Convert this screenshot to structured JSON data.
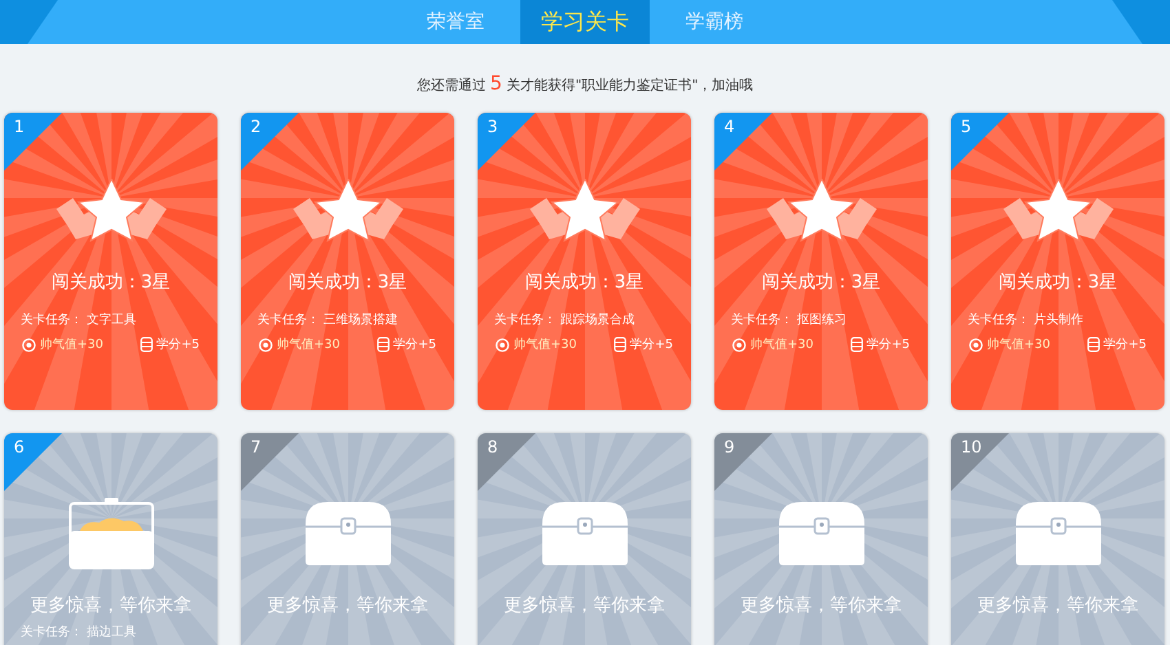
{
  "tabs": [
    {
      "label": "荣誉室",
      "selected": false
    },
    {
      "label": "学习关卡",
      "selected": true
    },
    {
      "label": "学霸榜",
      "selected": false
    }
  ],
  "notice": {
    "before": "您还需通过",
    "count": "5",
    "after": "关才能获得\"职业能力鉴定证书\"，加油哦"
  },
  "levels": [
    {
      "number": "1",
      "kind": "completed",
      "title": "闯关成功：3星",
      "task_label": "关卡任务：",
      "task": "文字工具",
      "rewards": [
        {
          "kind": "coin",
          "text": "帅气值+30"
        },
        {
          "kind": "credit",
          "text": "学分+5"
        }
      ]
    },
    {
      "number": "2",
      "kind": "completed",
      "title": "闯关成功：3星",
      "task_label": "关卡任务：",
      "task": "三维场景搭建",
      "rewards": [
        {
          "kind": "coin",
          "text": "帅气值+30"
        },
        {
          "kind": "credit",
          "text": "学分+5"
        }
      ]
    },
    {
      "number": "3",
      "kind": "completed",
      "title": "闯关成功：3星",
      "task_label": "关卡任务：",
      "task": "跟踪场景合成",
      "rewards": [
        {
          "kind": "coin",
          "text": "帅气值+30"
        },
        {
          "kind": "credit",
          "text": "学分+5"
        }
      ]
    },
    {
      "number": "4",
      "kind": "completed",
      "title": "闯关成功：3星",
      "task_label": "关卡任务：",
      "task": "抠图练习",
      "rewards": [
        {
          "kind": "coin",
          "text": "帅气值+30"
        },
        {
          "kind": "credit",
          "text": "学分+5"
        }
      ]
    },
    {
      "number": "5",
      "kind": "completed",
      "title": "闯关成功：3星",
      "task_label": "关卡任务：",
      "task": "片头制作",
      "rewards": [
        {
          "kind": "coin",
          "text": "帅气值+30"
        },
        {
          "kind": "credit",
          "text": "学分+5"
        }
      ]
    },
    {
      "number": "6",
      "kind": "current",
      "title": "更多惊喜，等你来拿",
      "task_label": "关卡任务：",
      "task": "描边工具"
    },
    {
      "number": "7",
      "kind": "locked",
      "title": "更多惊喜，等你来拿"
    },
    {
      "number": "8",
      "kind": "locked",
      "title": "更多惊喜，等你来拿"
    },
    {
      "number": "9",
      "kind": "locked",
      "title": "更多惊喜，等你来拿"
    },
    {
      "number": "10",
      "kind": "locked",
      "title": "更多惊喜，等你来拿"
    }
  ]
}
